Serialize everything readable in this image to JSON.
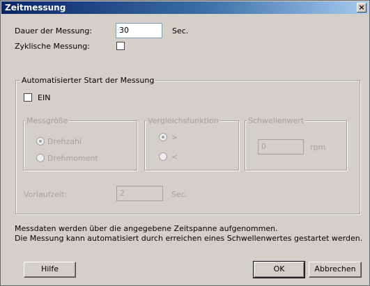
{
  "window": {
    "title": "Zeitmessung",
    "close_glyph": "×"
  },
  "duration": {
    "label": "Dauer der Messung:",
    "value": "30",
    "unit": "Sec."
  },
  "cyclic": {
    "label": "Zyklische Messung:",
    "checked": false
  },
  "auto_start": {
    "legend": "Automatisierter Start der Messung",
    "enable_label": "EIN",
    "enabled": false,
    "measure_group": {
      "legend": "Messgröße",
      "options": [
        "Drehzahl",
        "Drehmoment"
      ],
      "selected": "Drehzahl"
    },
    "compare_group": {
      "legend": "Vergleichsfunktion",
      "options": [
        ">",
        "<"
      ],
      "selected": ">"
    },
    "threshold_group": {
      "legend": "Schwellenwert",
      "value": "0",
      "unit": "rpm"
    },
    "lead_time": {
      "label": "Vorlaufzeit:",
      "value": "2",
      "unit": "Sec."
    }
  },
  "info": {
    "line1": "Messdaten werden über die angegebene Zeitspanne aufgenommen.",
    "line2": "Die Messung kann automatisiert durch erreichen eines Schwellenwertes gestartet werden."
  },
  "buttons": {
    "help": "Hilfe",
    "ok": "OK",
    "cancel": "Abbrechen"
  }
}
